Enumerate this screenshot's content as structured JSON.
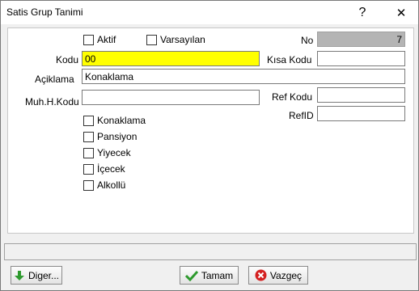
{
  "window": {
    "title": "Satis Grup Tanimi",
    "help_label": "?",
    "close_label": "✕"
  },
  "form": {
    "aktif_label": "Aktif",
    "varsayilan_label": "Varsayılan",
    "no_label": "No",
    "no_value": "7",
    "kodu_label": "Kodu",
    "kodu_value": "00",
    "kisa_kodu_label": "Kısa Kodu",
    "kisa_kodu_value": "",
    "aciklama_label": "Açiklama",
    "aciklama_value": "Konaklama",
    "muh_kodu_label": "Muh.H.Kodu",
    "muh_kodu_value": "",
    "ref_kodu_label": "Ref Kodu",
    "ref_kodu_value": "",
    "refid_label": "RefID",
    "refid_value": "",
    "categories": [
      {
        "label": "Konaklama"
      },
      {
        "label": "Pansiyon"
      },
      {
        "label": "Yiyecek"
      },
      {
        "label": "İçecek"
      },
      {
        "label": "Alkollü"
      }
    ]
  },
  "buttons": {
    "diger": "Diger...",
    "tamam": "Tamam",
    "vazgec": "Vazgeç"
  },
  "colors": {
    "kodu_highlight": "#ffff00",
    "no_field_bg": "#b4b4b4"
  }
}
